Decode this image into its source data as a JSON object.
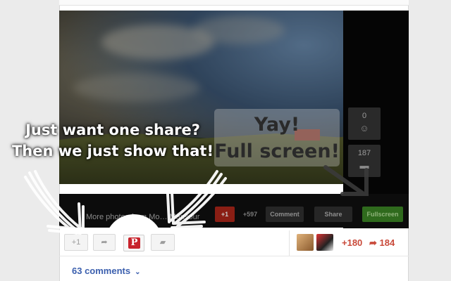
{
  "callout": {
    "line1": "Just want one share?",
    "line2": "Then we just show that!"
  },
  "overlay": {
    "line1": "Yay!",
    "line2": "Full screen!"
  },
  "side_counts": [
    {
      "value": "0",
      "icon": "smiley-icon"
    },
    {
      "value": "187",
      "icon": "comment-icon"
    }
  ],
  "strip": {
    "more_photos": "More photos from Mo…   Mansour",
    "plus_count": "+597",
    "comment_label": "Comment",
    "share_label": "Share",
    "fullscreen_label": "Fullscreen"
  },
  "share_row": {
    "plusone_label": "+1",
    "pinterest_letter": "P"
  },
  "stats": {
    "plus": "+180",
    "shares": "184"
  },
  "footer": {
    "comments_label": "63 comments"
  },
  "colors": {
    "pinterest_red": "#c8232c",
    "link_blue": "#3b5fae",
    "stat_red": "#c94a3a",
    "fullscreen_green": "#2f6a1d"
  }
}
